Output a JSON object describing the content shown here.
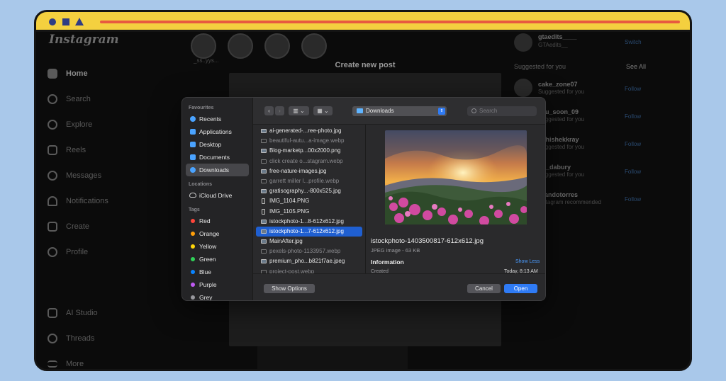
{
  "instagram": {
    "logo": "Instagram",
    "nav": [
      {
        "label": "Home",
        "active": true
      },
      {
        "label": "Search"
      },
      {
        "label": "Explore"
      },
      {
        "label": "Reels"
      },
      {
        "label": "Messages"
      },
      {
        "label": "Notifications"
      },
      {
        "label": "Create"
      },
      {
        "label": "Profile"
      }
    ],
    "nav_bottom": [
      {
        "label": "AI Studio"
      },
      {
        "label": "Threads"
      },
      {
        "label": "More"
      }
    ],
    "story_label": "_ss..yys...",
    "create_post_title": "Create new post",
    "account": {
      "username": "gtaedits____",
      "name": "GTAedits__",
      "switch": "Switch"
    },
    "suggested_header": "Suggested for you",
    "see_all": "See All",
    "suggestions": [
      {
        "name": "cake_zone07",
        "sub": "Suggested for you"
      },
      {
        "name": "e_u_soon_09",
        "sub": "Suggested for you"
      },
      {
        "name": "abhishekkray",
        "sub": "Suggested for you"
      },
      {
        "name": "nit_dabury",
        "sub": "Suggested for you"
      },
      {
        "name": "rnandotorres",
        "sub": "Instagram recommended"
      }
    ],
    "follow_label": "Follow"
  },
  "dialog": {
    "sidebar": {
      "favourites_heading": "Favourites",
      "favourites": [
        "Recents",
        "Applications",
        "Desktop",
        "Documents",
        "Downloads"
      ],
      "selected": "Downloads",
      "locations_heading": "Locations",
      "locations": [
        "iCloud Drive"
      ],
      "tags_heading": "Tags",
      "tags": [
        {
          "label": "Red",
          "color": "#ff453a"
        },
        {
          "label": "Orange",
          "color": "#ff9f0a"
        },
        {
          "label": "Yellow",
          "color": "#ffd60a"
        },
        {
          "label": "Green",
          "color": "#30d158"
        },
        {
          "label": "Blue",
          "color": "#0a84ff"
        },
        {
          "label": "Purple",
          "color": "#bf5af2"
        },
        {
          "label": "Grey",
          "color": "#98989d"
        }
      ]
    },
    "toolbar": {
      "back_icon": "chevron-left-icon",
      "forward_icon": "chevron-right-icon",
      "location": "Downloads",
      "search_placeholder": "Search"
    },
    "files": [
      {
        "name": "ai-generated-...ree-photo.jpg",
        "dim": false
      },
      {
        "name": "beautiful-autu...a-image.webp",
        "dim": true
      },
      {
        "name": "Blog-marketp...00x2000.png",
        "dim": false
      },
      {
        "name": "click create o...stagram.webp",
        "dim": true
      },
      {
        "name": "free-nature-images.jpg",
        "dim": false
      },
      {
        "name": "garrett miller l...profile.webp",
        "dim": true
      },
      {
        "name": "gratisography...-800x525.jpg",
        "dim": false
      },
      {
        "name": "IMG_1104.PNG",
        "dim": false,
        "phone": true
      },
      {
        "name": "IMG_1105.PNG",
        "dim": false,
        "phone": true
      },
      {
        "name": "istockphoto-1...8-612x612.jpg",
        "dim": false
      },
      {
        "name": "istockphoto-1...7-612x612.jpg",
        "dim": false,
        "selected": true
      },
      {
        "name": "MainAfter.jpg",
        "dim": false
      },
      {
        "name": "pexels-photo-1133957.webp",
        "dim": true
      },
      {
        "name": "premium_pho...b821f7ae.jpeg",
        "dim": false
      },
      {
        "name": "project-post.webp",
        "dim": true
      }
    ],
    "preview": {
      "filename": "istockphoto-1403500817-612x612.jpg",
      "type": "JPEG image - 63 KB",
      "info_heading": "Information",
      "show_less": "Show Less",
      "created_label": "Created",
      "created_value": "Today, 8:13 AM"
    },
    "footer": {
      "show_options": "Show Options",
      "cancel": "Cancel",
      "open": "Open"
    }
  }
}
